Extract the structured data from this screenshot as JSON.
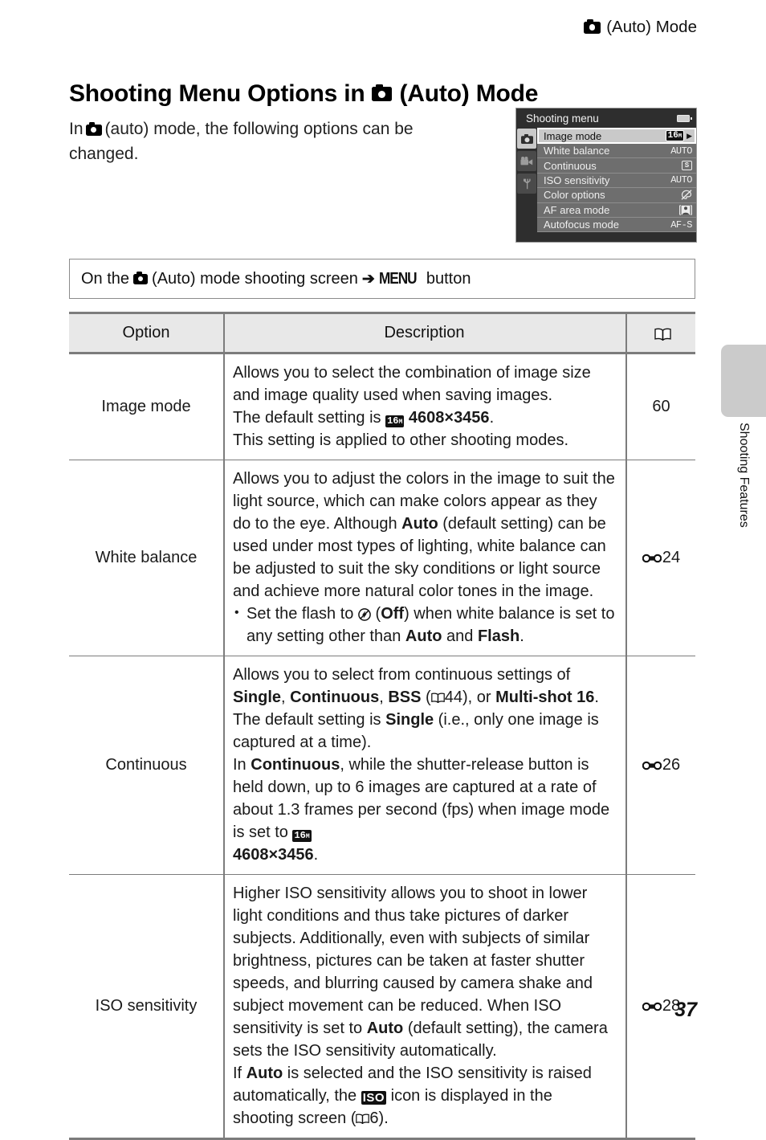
{
  "header": {
    "mode_icon": "camera-icon",
    "text": "(Auto) Mode"
  },
  "title": {
    "before_icon": "Shooting Menu Options in",
    "icon": "camera-icon",
    "after_icon": "(Auto) Mode"
  },
  "intro": {
    "part1": "In",
    "icon": "camera-icon",
    "part2": "(auto) mode, the following options can be changed."
  },
  "lcd": {
    "title": "Shooting menu",
    "battery_icon": "battery-icon",
    "tabs": [
      {
        "name": "shooting-tab",
        "icon": "camera-icon",
        "active": true
      },
      {
        "name": "movie-tab",
        "icon": "movie-camera-icon",
        "active": false
      },
      {
        "name": "setup-tab",
        "icon": "wrench-icon",
        "active": false
      }
    ],
    "rows": [
      {
        "label": "Image mode",
        "value": "16M",
        "value_kind": "badge16",
        "selected": true
      },
      {
        "label": "White balance",
        "value": "AUTO",
        "value_kind": "text",
        "selected": false
      },
      {
        "label": "Continuous",
        "value": "S",
        "value_kind": "boxed",
        "selected": false
      },
      {
        "label": "ISO sensitivity",
        "value": "AUTO",
        "value_kind": "text",
        "selected": false
      },
      {
        "label": "Color options",
        "value": "",
        "value_kind": "color-off-icon",
        "selected": false
      },
      {
        "label": "AF area mode",
        "value": "",
        "value_kind": "face-af-icon",
        "selected": false
      },
      {
        "label": "Autofocus mode",
        "value": "AF-S",
        "value_kind": "text",
        "selected": false
      }
    ]
  },
  "howto": {
    "part1": "On the",
    "icon": "camera-icon",
    "part2": "(Auto) mode shooting screen",
    "arrow": "➔",
    "menu_word": "MENU",
    "part3": "button"
  },
  "table": {
    "headers": {
      "option": "Option",
      "description": "Description",
      "reference": "book-icon"
    },
    "rows": [
      {
        "option": "Image mode",
        "reference": "60",
        "reference_kind": "plain",
        "description_lines": [
          "Allows you to select the combination of image size and image quality used when saving images.",
          "The default setting is [16M] 4608×3456.",
          "This setting is applied to other shooting modes."
        ]
      },
      {
        "option": "White balance",
        "reference": "24",
        "reference_kind": "esymbol",
        "description_lines": [
          "Allows you to adjust the colors in the image to suit the light source, which can make colors appear as they do to the eye. Although Auto (default setting) can be used under most types of lighting, white balance can be adjusted to suit the sky conditions or light source and achieve more natural color tones in the image.",
          "• Set the flash to [flash-off] (Off) when white balance is set to any setting other than Auto and Flash."
        ]
      },
      {
        "option": "Continuous",
        "reference": "26",
        "reference_kind": "esymbol",
        "description_lines": [
          "Allows you to select from continuous settings of Single, Continuous, BSS ([book]44), or Multi-shot 16. The default setting is Single (i.e., only one image is captured at a time).",
          "In Continuous, while the shutter-release button is held down, up to 6 images are captured at a rate of about 1.3 frames per second (fps) when image mode is set to [16M] 4608×3456."
        ]
      },
      {
        "option": "ISO sensitivity",
        "reference": "28",
        "reference_kind": "esymbol",
        "description_lines": [
          "Higher ISO sensitivity allows you to shoot in lower light conditions and thus take pictures of darker subjects. Additionally, even with subjects of similar brightness, pictures can be taken at faster shutter speeds, and blurring caused by camera shake and subject movement can be reduced. When ISO sensitivity is set to Auto (default setting), the camera sets the ISO sensitivity automatically.",
          "If Auto is selected and the ISO sensitivity is raised automatically, the [ISO] icon is displayed in the shooting screen ([book]6)."
        ]
      }
    ]
  },
  "side_tab": {
    "label": "Shooting Features"
  },
  "footer": {
    "page_number": "37"
  },
  "colors": {
    "rule": "#7c7c7c",
    "header_fill": "#e8e8e8",
    "side_tab": "#cbcbcb",
    "lcd_bg": "#2e2e2e",
    "lcd_row": "#6e6e6e",
    "lcd_selected": "#c9c9c9"
  }
}
